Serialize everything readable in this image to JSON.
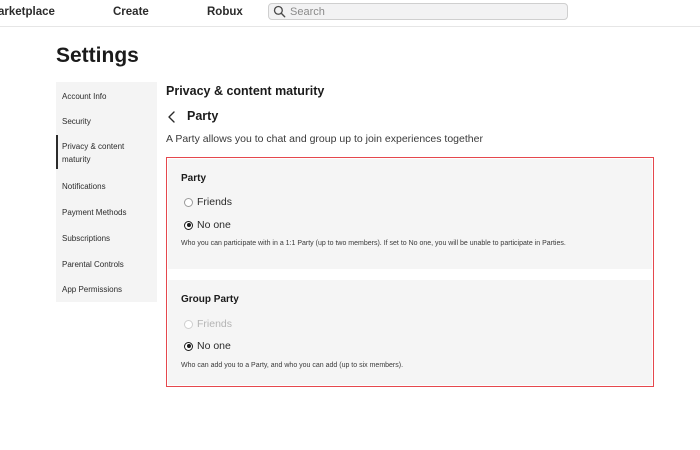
{
  "topbar": {
    "marketplace_label": "arketplace",
    "create_label": "Create",
    "robux_label": "Robux",
    "search_placeholder": "Search"
  },
  "page": {
    "title": "Settings"
  },
  "sidebar": {
    "items": [
      {
        "label": "Account Info"
      },
      {
        "label": "Security"
      },
      {
        "label": "Privacy & content maturity",
        "active": true
      },
      {
        "label": "Notifications"
      },
      {
        "label": "Payment Methods"
      },
      {
        "label": "Subscriptions"
      },
      {
        "label": "Parental Controls"
      },
      {
        "label": "App Permissions"
      }
    ]
  },
  "main": {
    "section_title": "Privacy & content maturity",
    "subsection_title": "Party",
    "description": "A Party allows you to chat and group up to join experiences together",
    "highlight_color": "#e5484d",
    "party": {
      "title": "Party",
      "options": [
        {
          "label": "Friends",
          "selected": false,
          "disabled": false
        },
        {
          "label": "No one",
          "selected": true,
          "disabled": false
        }
      ],
      "help": "Who you can participate with in a 1:1 Party (up to two members). If set to No one, you will be unable to participate in Parties."
    },
    "group_party": {
      "title": "Group Party",
      "options": [
        {
          "label": "Friends",
          "selected": false,
          "disabled": true
        },
        {
          "label": "No one",
          "selected": true,
          "disabled": false
        }
      ],
      "help": "Who can add you to a Party, and who you can add (up to six members)."
    }
  }
}
